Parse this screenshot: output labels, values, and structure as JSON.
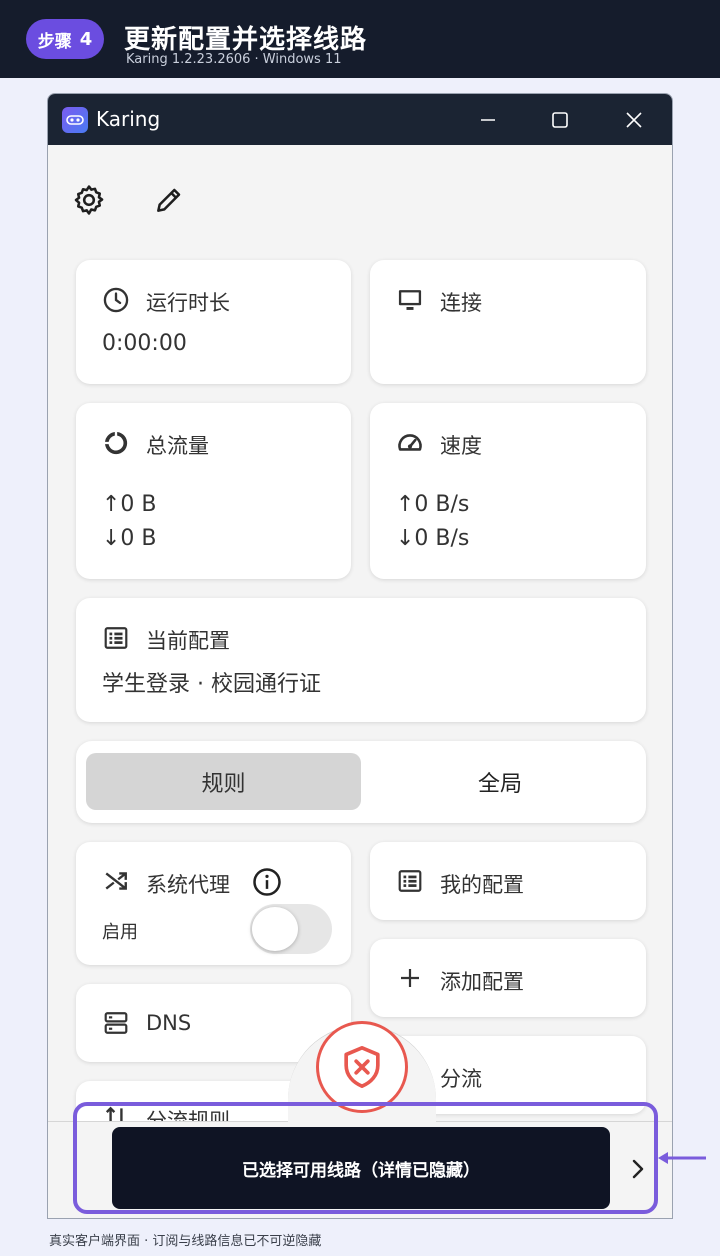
{
  "step": {
    "label": "步骤",
    "number": "4"
  },
  "page": {
    "title": "更新配置并选择线路",
    "subtitle": "Karing 1.2.23.2606 · Windows 11",
    "footer": "真实客户端界面 · 订阅与线路信息已不可逆隐藏"
  },
  "window": {
    "title": "Karing"
  },
  "cards": {
    "runtime": {
      "label": "运行时长",
      "value": "0:00:00"
    },
    "connections": {
      "label": "连接"
    },
    "traffic": {
      "label": "总流量",
      "up": "↑0 B",
      "down": "↓0 B"
    },
    "speed": {
      "label": "速度",
      "up": "↑0 B/s",
      "down": "↓0 B/s"
    },
    "current_profile": {
      "label": "当前配置",
      "value": "学生登录 · 校园通行证"
    }
  },
  "mode": {
    "rule": "规则",
    "global": "全局",
    "selected": "规则"
  },
  "system_proxy": {
    "label": "系统代理",
    "toggle_label": "启用",
    "enabled": false
  },
  "menu": {
    "my_profiles": "我的配置",
    "add_profile": "添加配置",
    "dns": "DNS",
    "routing": "分流",
    "routing_rules": "分流规则"
  },
  "connect_button": "已选择可用线路（详情已隐藏）",
  "colors": {
    "accent": "#6b4de0",
    "highlight": "#7a5cdc",
    "danger": "#e8584f",
    "dark": "#151c2c"
  }
}
